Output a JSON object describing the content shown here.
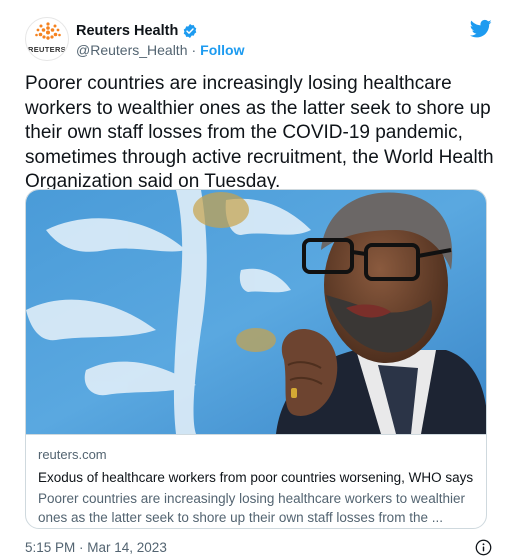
{
  "author": {
    "display_name": "Reuters Health",
    "handle": "@Reuters_Health",
    "separator": "·",
    "follow_label": "Follow",
    "avatar_text": "REUTERS",
    "verified": true
  },
  "tweet": {
    "text": "Poorer countries are increasingly losing healthcare workers to wealthier ones as the latter seek to shore up their own staff losses from the COVID-19 pandemic, sometimes through active recruitment, the World Health Organization said on Tuesday.",
    "timestamp": "5:15 PM · Mar 14, 2023"
  },
  "card": {
    "domain": "reuters.com",
    "title": "Exodus of healthcare workers from poor countries worsening, WHO says",
    "description": "Poorer countries are increasingly losing healthcare workers to wealthier ones as the latter seek to shore up their own staff losses from the ...",
    "image_alt": "photo"
  },
  "icons": {
    "brand": "twitter-bird-icon",
    "verified": "verified-badge-icon",
    "info": "info-icon",
    "avatar": "reuters-logo"
  },
  "colors": {
    "accent": "#1d9bf0",
    "text": "#0f1419",
    "secondary": "#536471",
    "border": "#cfd9de",
    "reuters_orange": "#f5821f"
  }
}
